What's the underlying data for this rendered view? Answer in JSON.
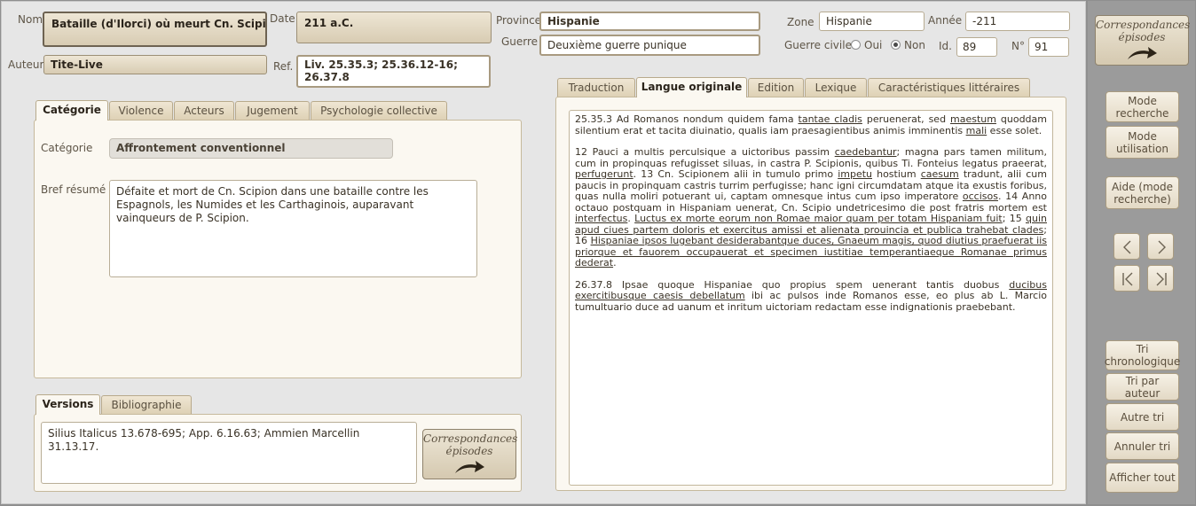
{
  "header": {
    "nom_label": "Nom",
    "nom_value": "Bataille (d'Ilorci) où meurt Cn. Scipion",
    "date_label": "Date",
    "date_value": "211 a.C.",
    "province_label": "Province",
    "province_value": "Hispanie",
    "guerre_label": "Guerre",
    "guerre_value": "Deuxième guerre punique",
    "zone_label": "Zone",
    "zone_value": "Hispanie",
    "annee_label": "Année",
    "annee_value": "-211",
    "guerre_civile_label": "Guerre civile",
    "oui_label": "Oui",
    "non_label": "Non",
    "guerre_civile_selected": "Non",
    "id_label": "Id.",
    "id_value": "89",
    "numero_label": "N°",
    "numero_value": "91",
    "auteur_label": "Auteur",
    "auteur_value": "Tite-Live",
    "ref_label": "Ref.",
    "ref_value": "Liv. 25.35.3; 25.36.12-16; 26.37.8"
  },
  "left_tabs": [
    {
      "label": "Catégorie",
      "active": true
    },
    {
      "label": "Violence",
      "active": false
    },
    {
      "label": "Acteurs",
      "active": false
    },
    {
      "label": "Jugement",
      "active": false
    },
    {
      "label": "Psychologie collective",
      "active": false
    }
  ],
  "categorie_panel": {
    "categorie_label": "Catégorie",
    "categorie_value": "Affrontement conventionnel",
    "resume_label": "Bref résumé",
    "resume_value": "Défaite et mort de Cn. Scipion dans une bataille contre les Espagnols, les Numides et les Carthaginois, auparavant vainqueurs de P. Scipion."
  },
  "bottom_tabs": [
    {
      "label": "Versions",
      "active": true
    },
    {
      "label": "Bibliographie",
      "active": false
    }
  ],
  "versions_value": "Silius Italicus 13.678-695; App. 6.16.63; Ammien Marcellin 31.13.17.",
  "correspondances_label_1": "Correspondances",
  "correspondances_label_2": "épisodes",
  "right_tabs": [
    {
      "label": "Traduction",
      "active": false
    },
    {
      "label": "Langue originale",
      "active": true
    },
    {
      "label": "Edition",
      "active": false
    },
    {
      "label": "Lexique",
      "active": false
    },
    {
      "label": "Caractéristiques littéraires",
      "active": false
    }
  ],
  "original_text": {
    "p1": [
      {
        "t": "25.35.3 Ad Romanos nondum quidem fama ",
        "u": false
      },
      {
        "t": "tantae cladis",
        "u": true
      },
      {
        "t": " peruenerat, sed ",
        "u": false
      },
      {
        "t": "maestum",
        "u": true
      },
      {
        "t": " quoddam silentium erat et tacita diuinatio, qualis iam praesagientibus animis imminentis ",
        "u": false
      },
      {
        "t": "mali",
        "u": true
      },
      {
        "t": " esse solet.",
        "u": false
      }
    ],
    "p2": [
      {
        "t": "12 Pauci a multis perculsique a uictoribus passim ",
        "u": false
      },
      {
        "t": "caedebantur",
        "u": true
      },
      {
        "t": "; magna pars tamen militum, cum in propinquas refugisset siluas, in castra P. Scipionis, quibus Ti. Fonteius legatus praeerat, ",
        "u": false
      },
      {
        "t": "perfugerunt",
        "u": true
      },
      {
        "t": ". 13 Cn. Scipionem alii in tumulo primo ",
        "u": false
      },
      {
        "t": "impetu",
        "u": true
      },
      {
        "t": " hostium ",
        "u": false
      },
      {
        "t": "caesum",
        "u": true
      },
      {
        "t": " tradunt, alii cum paucis in propinquam castris turrim perfugisse; hanc igni circumdatam atque ita exustis foribus, quas nulla moliri potuerant ui, captam omnesque intus cum ipso imperatore ",
        "u": false
      },
      {
        "t": "occisos",
        "u": true
      },
      {
        "t": ". 14 Anno octauo postquam in Hispaniam uenerat, Cn. Scipio undetricesimo die post fratris mortem est ",
        "u": false
      },
      {
        "t": "interfectus",
        "u": true
      },
      {
        "t": ". ",
        "u": false
      },
      {
        "t": "Luctus ex morte eorum non Romae maior quam per totam Hispaniam fuit",
        "u": true
      },
      {
        "t": "; 15 ",
        "u": false
      },
      {
        "t": "quin apud ciues partem doloris et exercitus amissi et alienata prouincia et publica trahebat clades",
        "u": true
      },
      {
        "t": "; 16 ",
        "u": false
      },
      {
        "t": "Hispaniae ipsos lugebant desiderabantque duces, Gnaeum magis, quod diutius praefuerat iis priorque et fauorem occupauerat et specimen iustitiae temperantiaeque Romanae primus dederat",
        "u": true
      },
      {
        "t": ".",
        "u": false
      }
    ],
    "p3": [
      {
        "t": "26.37.8 Ipsae quoque Hispaniae quo propius spem uenerant tantis duobus ",
        "u": false
      },
      {
        "t": "ducibus exercitibusque caesis debellatum",
        "u": true
      },
      {
        "t": " ibi ac pulsos inde Romanos esse, eo plus ab L. Marcio tumultuario duce ad uanum et inritum uictoriam redactam esse indignationis praebebant.",
        "u": false
      }
    ]
  },
  "sidebar": {
    "mode_recherche": "Mode recherche",
    "mode_utilisation": "Mode utilisation",
    "aide": "Aide (mode recherche)",
    "tri_chrono": "Tri chronologique",
    "tri_auteur": "Tri par auteur",
    "autre_tri": "Autre tri",
    "annuler_tri": "Annuler tri",
    "afficher_tout": "Afficher tout"
  }
}
